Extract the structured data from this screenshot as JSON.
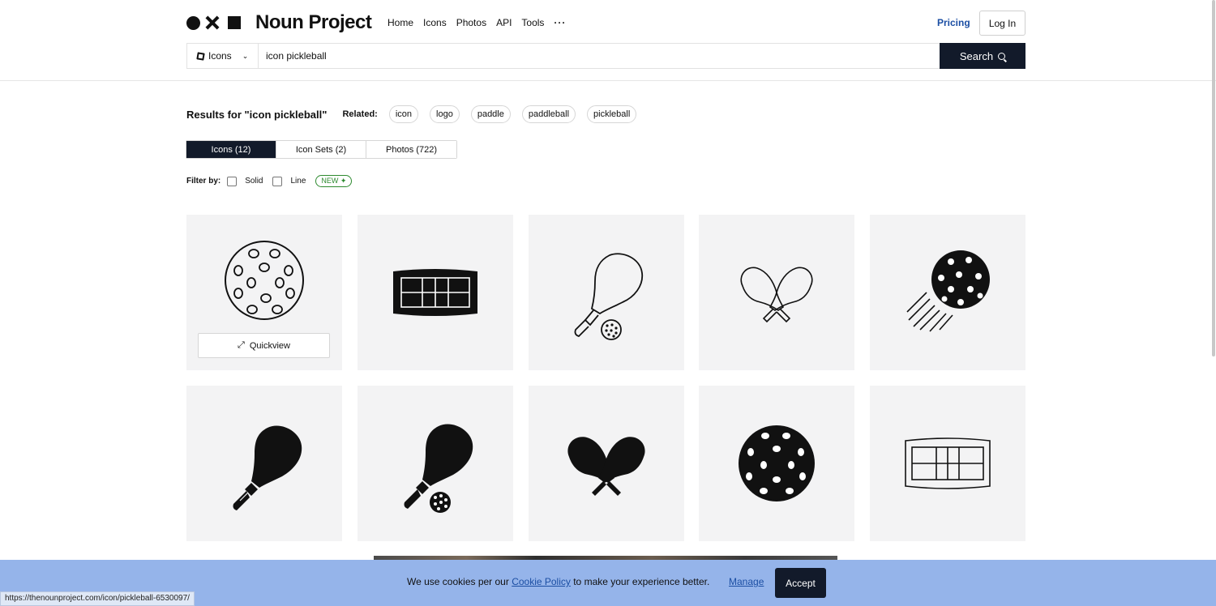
{
  "brand": {
    "name": "Noun Project"
  },
  "nav": {
    "items": [
      "Home",
      "Icons",
      "Photos",
      "API",
      "Tools"
    ],
    "more": "···",
    "pricing": "Pricing",
    "login": "Log In"
  },
  "search": {
    "type_label": "Icons",
    "query": "icon pickleball",
    "button_label": "Search"
  },
  "results": {
    "title": "Results for \"icon pickleball\"",
    "related_label": "Related:",
    "related": [
      "icon",
      "logo",
      "paddle",
      "paddleball",
      "pickleball"
    ]
  },
  "tabs": [
    {
      "label": "Icons (12)",
      "active": true
    },
    {
      "label": "Icon Sets (2)",
      "active": false
    },
    {
      "label": "Photos (722)",
      "active": false
    }
  ],
  "filters": {
    "label": "Filter by:",
    "options": [
      "Solid",
      "Line"
    ],
    "badge": "NEW ✦"
  },
  "icons": [
    {
      "name": "pickleball-outline-icon"
    },
    {
      "name": "court-solid-icon"
    },
    {
      "name": "paddle-ball-outline-icon"
    },
    {
      "name": "crossed-paddles-outline-icon"
    },
    {
      "name": "ball-motion-solid-icon"
    },
    {
      "name": "paddle-solid-icon"
    },
    {
      "name": "paddle-ball-solid-icon"
    },
    {
      "name": "crossed-paddles-solid-icon"
    },
    {
      "name": "pickleball-solid-icon"
    },
    {
      "name": "court-outline-icon"
    }
  ],
  "quickview_label": "Quickview",
  "cookie": {
    "text_before": "We use cookies per our ",
    "link": "Cookie Policy",
    "text_after": " to make your experience better.",
    "manage": "Manage",
    "accept": "Accept"
  },
  "status_url": "https://thenounproject.com/icon/pickleball-6530097/"
}
